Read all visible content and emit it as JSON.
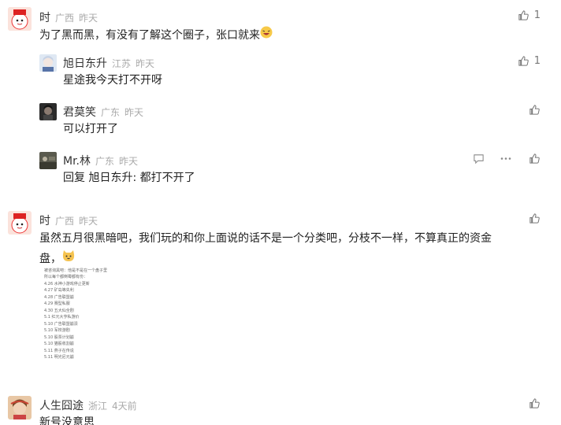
{
  "comments": [
    {
      "user": "时",
      "location": "广西",
      "time": "昨天",
      "text": "为了黑而黑，有没有了解这个圈子，张口就来",
      "likes": "1",
      "replies": [
        {
          "user": "旭日东升",
          "location": "江苏",
          "time": "昨天",
          "text": "星途我今天打不开呀",
          "likes": "1"
        },
        {
          "user": "君莫笑",
          "location": "广东",
          "time": "昨天",
          "text": "可以打开了",
          "likes": ""
        },
        {
          "user": "Mr.林",
          "location": "广东",
          "time": "昨天",
          "text_prefix": "回复",
          "reply_to": "旭日东升",
          "text": ": 都打不开了",
          "likes": ""
        }
      ]
    },
    {
      "user": "时",
      "location": "广西",
      "time": "昨天",
      "text_line1": "虽然五月很黑暗吧，我们玩的和你上面说的话不是一个分类吧，分枝不一样，不算真正的资金",
      "text_line2": "盘，",
      "likes": "",
      "image_lines": [
        "被咨询黑吧：他是不是在一个盘子里",
        "所以每个都倒霉都有份：",
        "4.26 水神小游戏停止更新",
        "4.27 矿岛等失利",
        "4.28 广告联盟崩",
        "4.29 赛型私服",
        "4.30 五大仙全剧",
        "5.1 红元大亨私游价",
        "5.10 广告联盟崩溃",
        "5.10 军校游剧",
        "5.10 股票计划崩",
        "5.10 猫股收割崩",
        "5.11 燕子在传说",
        "5.11 明光尼元崩"
      ]
    },
    {
      "user": "人生囧途",
      "location": "浙江",
      "time": "4天前",
      "text": "新号没意思",
      "likes": ""
    }
  ],
  "colors": {
    "muted": "#aaaaaa",
    "text": "#222222",
    "icon": "#777777"
  }
}
